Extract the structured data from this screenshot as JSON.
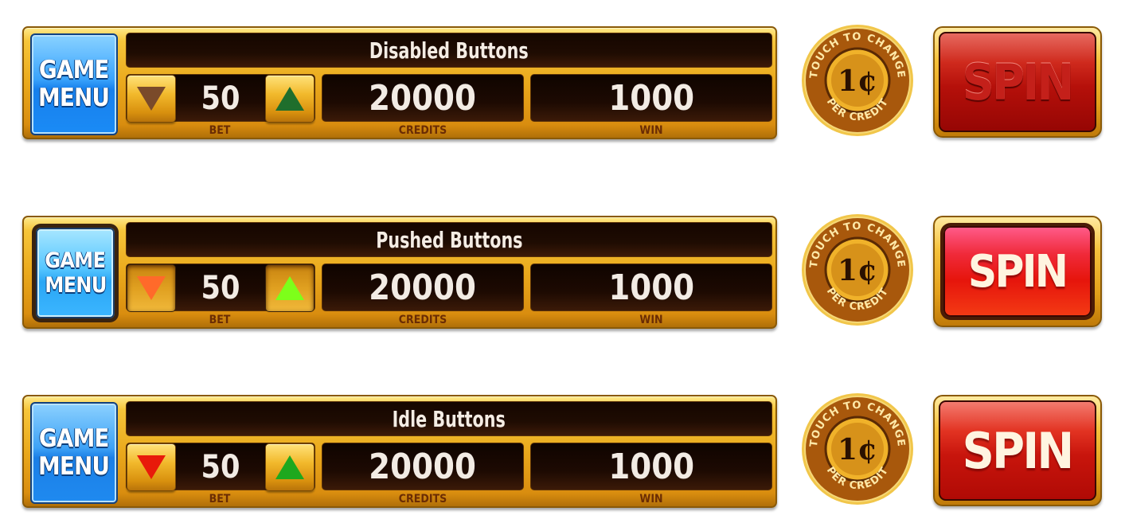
{
  "rows": [
    {
      "state": "disabled",
      "title": "Disabled Buttons",
      "menu": {
        "line1": "GAME",
        "line2": "MENU"
      },
      "bet": "50",
      "credits": "20000",
      "win": "1000",
      "labels": {
        "bet": "BET",
        "credits": "CREDITS",
        "win": "WIN"
      },
      "coin": {
        "top_text": "TOUCH TO CHANGE",
        "value": "1¢",
        "bottom_text": "PER CREDIT"
      },
      "spin_label": "SPIN",
      "colors": {
        "down_arrow": "#7a4a2a",
        "up_arrow": "#1f6e2c"
      }
    },
    {
      "state": "pushed",
      "title": "Pushed Buttons",
      "menu": {
        "line1": "GAME",
        "line2": "MENU"
      },
      "bet": "50",
      "credits": "20000",
      "win": "1000",
      "labels": {
        "bet": "BET",
        "credits": "CREDITS",
        "win": "WIN"
      },
      "coin": {
        "top_text": "TOUCH TO CHANGE",
        "value": "1¢",
        "bottom_text": "PER CREDIT"
      },
      "spin_label": "SPIN",
      "colors": {
        "down_arrow": "#ff6a2a",
        "up_arrow": "#7dff1a"
      }
    },
    {
      "state": "idle",
      "title": "Idle Buttons",
      "menu": {
        "line1": "GAME",
        "line2": "MENU"
      },
      "bet": "50",
      "credits": "20000",
      "win": "1000",
      "labels": {
        "bet": "BET",
        "credits": "CREDITS",
        "win": "WIN"
      },
      "coin": {
        "top_text": "TOUCH TO CHANGE",
        "value": "1¢",
        "bottom_text": "PER CREDIT"
      },
      "spin_label": "SPIN",
      "colors": {
        "down_arrow": "#e81a0a",
        "up_arrow": "#1ea81e"
      }
    }
  ]
}
